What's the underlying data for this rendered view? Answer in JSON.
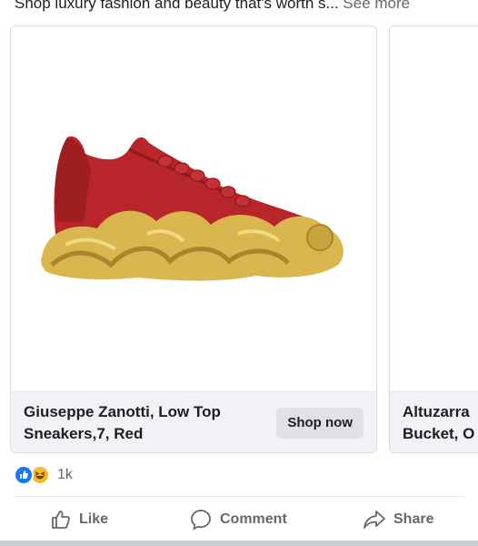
{
  "post": {
    "caption": "Shop luxury fashion and beauty that's worth s...",
    "see_more": "See more"
  },
  "carousel": {
    "cards": [
      {
        "title": "Giuseppe Zanotti, Low Top Sneakers,7, Red",
        "button": "Shop now",
        "image": "red-gold-snake-sneaker"
      },
      {
        "title": "Altuzarra\nBucket, O",
        "image": "partial-product"
      }
    ]
  },
  "reactions": {
    "count": "1k",
    "icons": [
      "like-reaction-icon",
      "haha-reaction-icon"
    ]
  },
  "actions": {
    "like": "Like",
    "comment": "Comment",
    "share": "Share"
  },
  "colors": {
    "like_blue": "#1877f2",
    "haha_yellow": "#f7b928",
    "shoe_red": "#b8262b",
    "sole_gold": "#d9b64e"
  }
}
